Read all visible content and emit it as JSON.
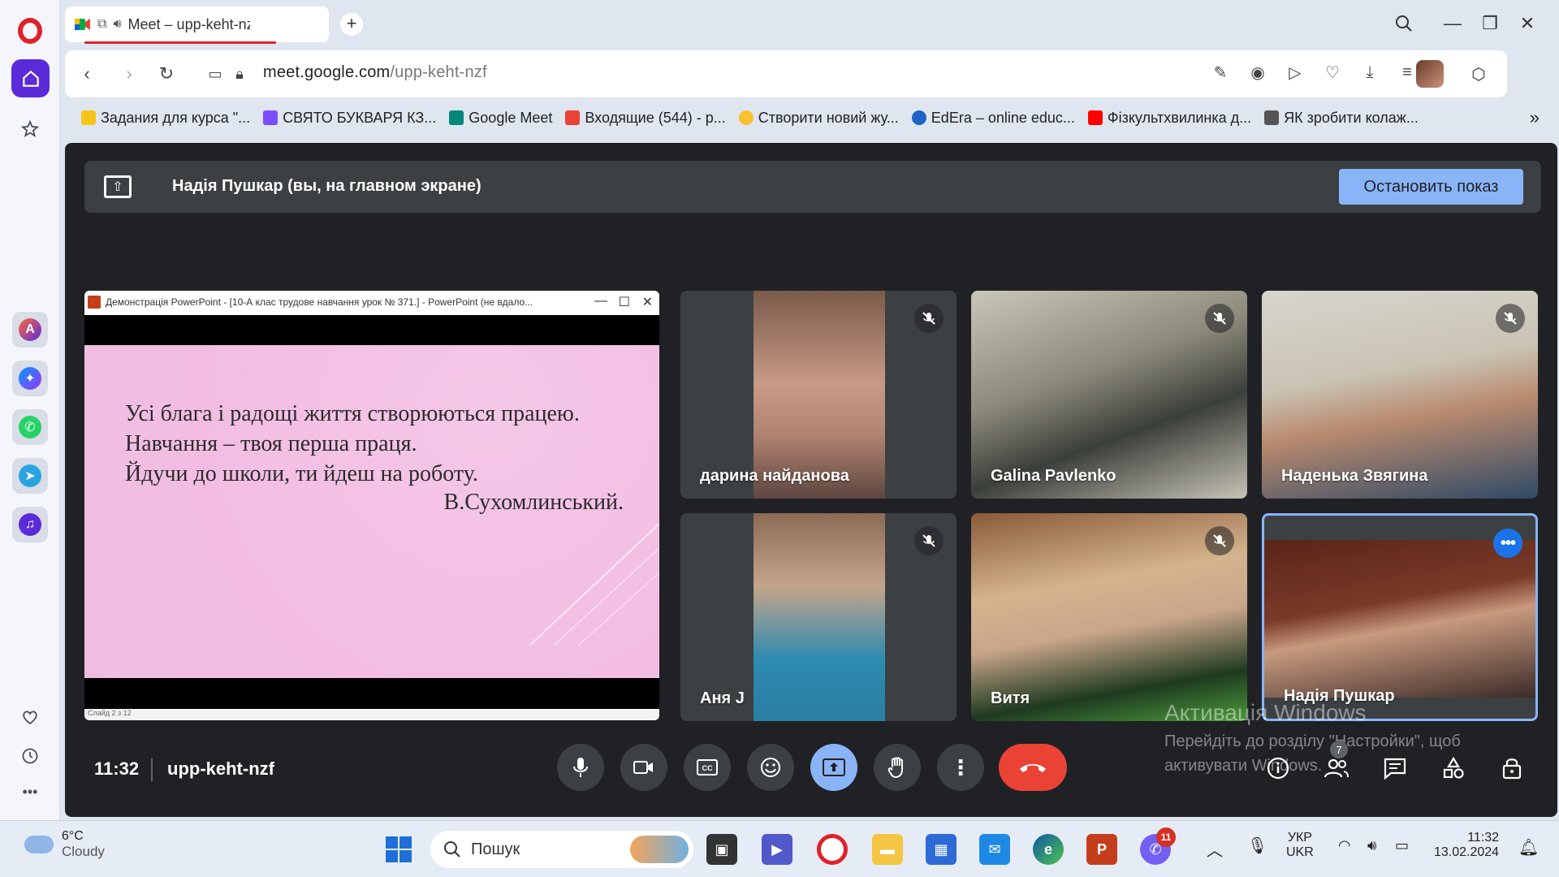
{
  "browser": {
    "tab_title": "Meet – upp-keht-nzf",
    "url_host": "meet.google.com",
    "url_path": "/upp-keht-nzf",
    "new_tab_label": "+"
  },
  "bookmarks": [
    {
      "label": "Задания для курса \"...",
      "color": "#f5c518"
    },
    {
      "label": "СВЯТО БУКВАРЯ КЗ...",
      "color": "#7c4dff"
    },
    {
      "label": "Google Meet",
      "color": "#00897b"
    },
    {
      "label": "Входящие (544) - p...",
      "color": "#ea4335"
    },
    {
      "label": "Створити новий жу...",
      "color": "#fbc02d"
    },
    {
      "label": "EdEra – online educ...",
      "color": "#1e63c7"
    },
    {
      "label": "Фізкультхвилинка д...",
      "color": "#ff0000"
    },
    {
      "label": "ЯК зробити колаж...",
      "color": "#555555"
    }
  ],
  "meet": {
    "presenting_text": "Надія Пушкар (вы, на главном экране)",
    "stop_button": "Остановить показ",
    "time": "11:32",
    "meeting_code": "upp-keht-nzf",
    "participants_count": "7",
    "presentation": {
      "window_title": "Демонстрація PowerPoint - [10-А клас трудове навчання урок № 371.] - PowerPoint (не вдало...",
      "slide_lines": [
        "Усі блага і радощі життя створюються працею.",
        "Навчання – твоя перша праця.",
        "Йдучи до школи, ти йдеш на роботу."
      ],
      "slide_author": "В.Сухомлинський.",
      "status_text": "Слайд 2 з 12"
    },
    "participants": [
      {
        "name": "дарина найданова",
        "muted": true
      },
      {
        "name": "Galina Pavlenko",
        "muted": true
      },
      {
        "name": "Наденька Звягина",
        "muted": true
      },
      {
        "name": "Аня J",
        "muted": true
      },
      {
        "name": "Витя",
        "muted": true
      },
      {
        "name": "Надія Пушкар",
        "muted": false
      }
    ]
  },
  "watermark": {
    "line1": "Активація Windows",
    "line2": "Перейдіть до розділу \"Настройки\", щоб",
    "line3": "активувати Windows."
  },
  "taskbar": {
    "temperature": "6°C",
    "weather": "Cloudy",
    "search_placeholder": "Пошук",
    "lang_top": "УКР",
    "lang_bottom": "UKR",
    "clock_time": "11:32",
    "clock_date": "13.02.2024",
    "viber_badge": "11"
  },
  "colors": {
    "meet_bg": "#202124",
    "accent_blue": "#8ab4f8",
    "end_call_red": "#ea4335",
    "opera_red": "#e0212b",
    "opera_purple": "#5b2bd9"
  }
}
